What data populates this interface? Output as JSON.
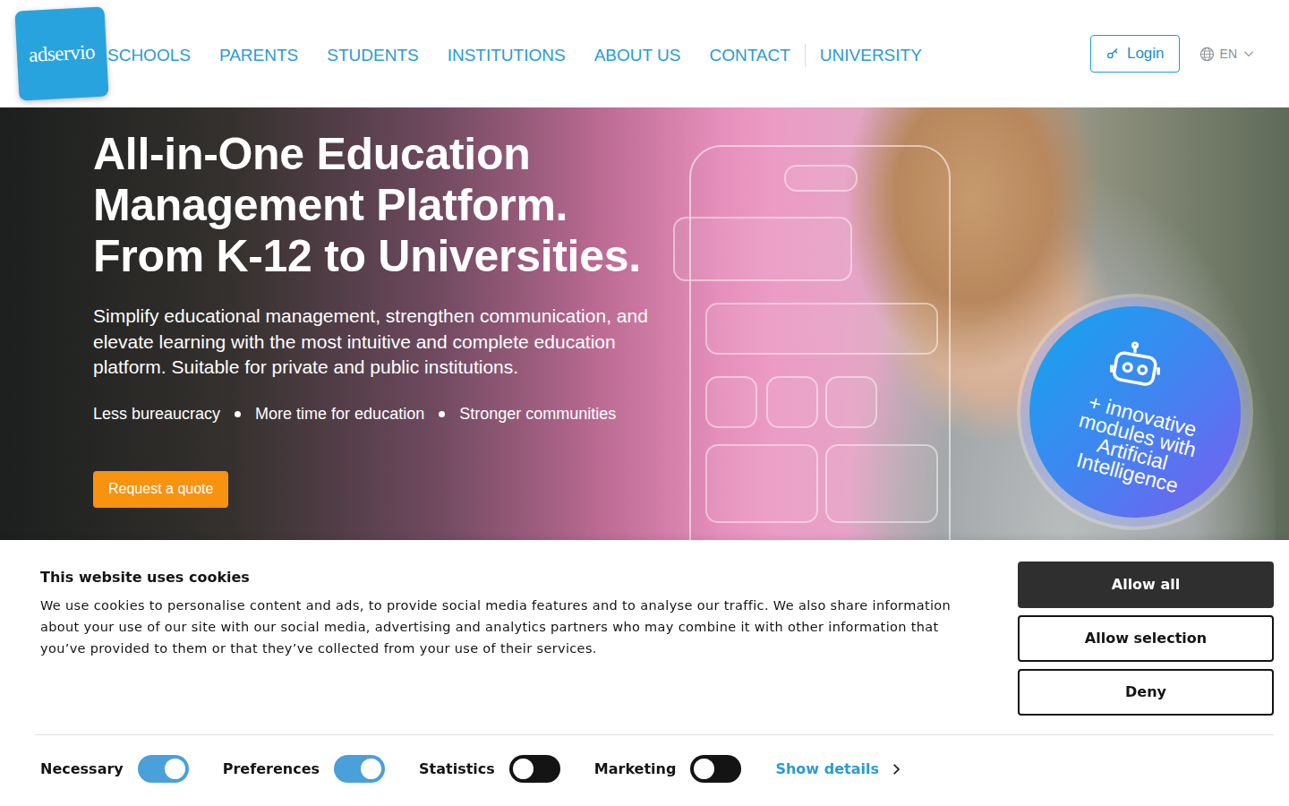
{
  "header": {
    "logo": "adservio",
    "nav": [
      {
        "label": "SCHOOLS",
        "divider_before": false
      },
      {
        "label": "PARENTS",
        "divider_before": false
      },
      {
        "label": "STUDENTS",
        "divider_before": false
      },
      {
        "label": "INSTITUTIONS",
        "divider_before": false
      },
      {
        "label": "ABOUT US",
        "divider_before": false
      },
      {
        "label": "CONTACT",
        "divider_before": false
      },
      {
        "label": "UNIVERSITY",
        "divider_before": true
      }
    ],
    "login": "Login",
    "language": "EN"
  },
  "hero": {
    "headline": [
      "All-in-One Education",
      "Management Platform.",
      "From K-12 to Universities."
    ],
    "subtitle": "Simplify educational management, strengthen communication, and elevate learning with the most intuitive and complete education platform. Suitable for private and public institutions.",
    "benefits": [
      "Less bureaucracy",
      "More time for education",
      "Stronger communities"
    ],
    "cta": "Request a quote",
    "badge": "+ innovative modules with Artificial Intelligence"
  },
  "cookie_banner": {
    "title": "This website uses cookies",
    "text": "We use cookies to personalise content and ads, to provide social media features and to analyse our traffic. We also share information about your use of our site with our social media, advertising and analytics partners who may combine it with other information that you’ve provided to them or that they’ve collected from your use of their services.",
    "buttons": [
      "Allow all",
      "Allow selection",
      "Deny"
    ],
    "toggles": [
      {
        "label": "Necessary",
        "on": true
      },
      {
        "label": "Preferences",
        "on": true
      },
      {
        "label": "Statistics",
        "on": false
      },
      {
        "label": "Marketing",
        "on": false
      }
    ],
    "details_link": "Show details"
  }
}
